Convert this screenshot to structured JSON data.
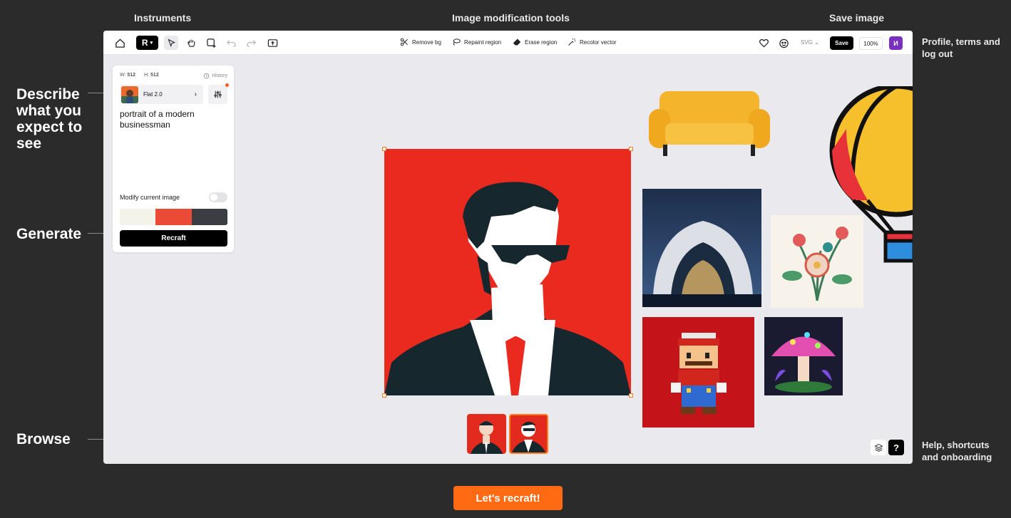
{
  "annotations": {
    "instruments": "Instruments",
    "image_tools": "Image modification tools",
    "save_image": "Save image",
    "describe": "Describe what you expect to see",
    "generate": "Generate",
    "browse": "Browse",
    "profile": "Profile, terms and log out",
    "help": "Help, shortcuts and onboarding"
  },
  "toolbar": {
    "tools": {
      "remove_bg": "Remove bg",
      "repaint": "Repaint region",
      "erase": "Erase region",
      "recolor": "Recolor vector"
    },
    "format": "SVG",
    "save_label": "Save",
    "zoom": "100%",
    "avatar_initial": "И"
  },
  "panel": {
    "width_label": "W:",
    "width_value": "512",
    "height_label": "H:",
    "height_value": "512",
    "history": "History",
    "style_name": "Flat 2.0",
    "prompt": "portrait of a modern businessman",
    "modify_label": "Modify current image",
    "palette": [
      "#f4f3ea",
      "#ea4a36",
      "#3a3d42"
    ],
    "recraft_label": "Recraft"
  },
  "cta": "Let's recraft!",
  "colors": {
    "accent": "#ff6a13",
    "portrait_red": "#ea2a1e",
    "avatar_purple": "#7b2fbe"
  }
}
